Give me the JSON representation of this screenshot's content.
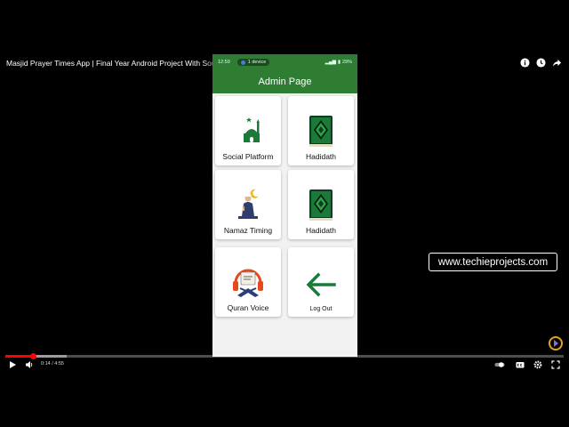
{
  "video": {
    "title": "Masjid Prayer Times App | Final Year Android Project With Source Code",
    "time": "0:14 / 4:55",
    "progress_fraction": 0.05,
    "buffer_fraction": 0.11,
    "watermark": "www.techieprojects.com"
  },
  "phone": {
    "status": {
      "time": "12:59",
      "device_label": "1 device",
      "battery": "29%"
    },
    "appbar_title": "Admin Page",
    "cards": [
      {
        "label": "Social Platform",
        "icon": "mosque-icon"
      },
      {
        "label": "Hadidath",
        "icon": "quran-book-icon"
      },
      {
        "label": "Namaz Timing",
        "icon": "praying-man-icon"
      },
      {
        "label": "Hadidath",
        "icon": "quran-book-icon"
      },
      {
        "label": "Quran Voice",
        "icon": "quran-headphones-icon"
      },
      {
        "label": "Log Out",
        "icon": "arrow-left-icon"
      }
    ]
  },
  "colors": {
    "appbar": "#2e7d32",
    "accent_green": "#1b7a3a",
    "progress": "#ff0000"
  }
}
